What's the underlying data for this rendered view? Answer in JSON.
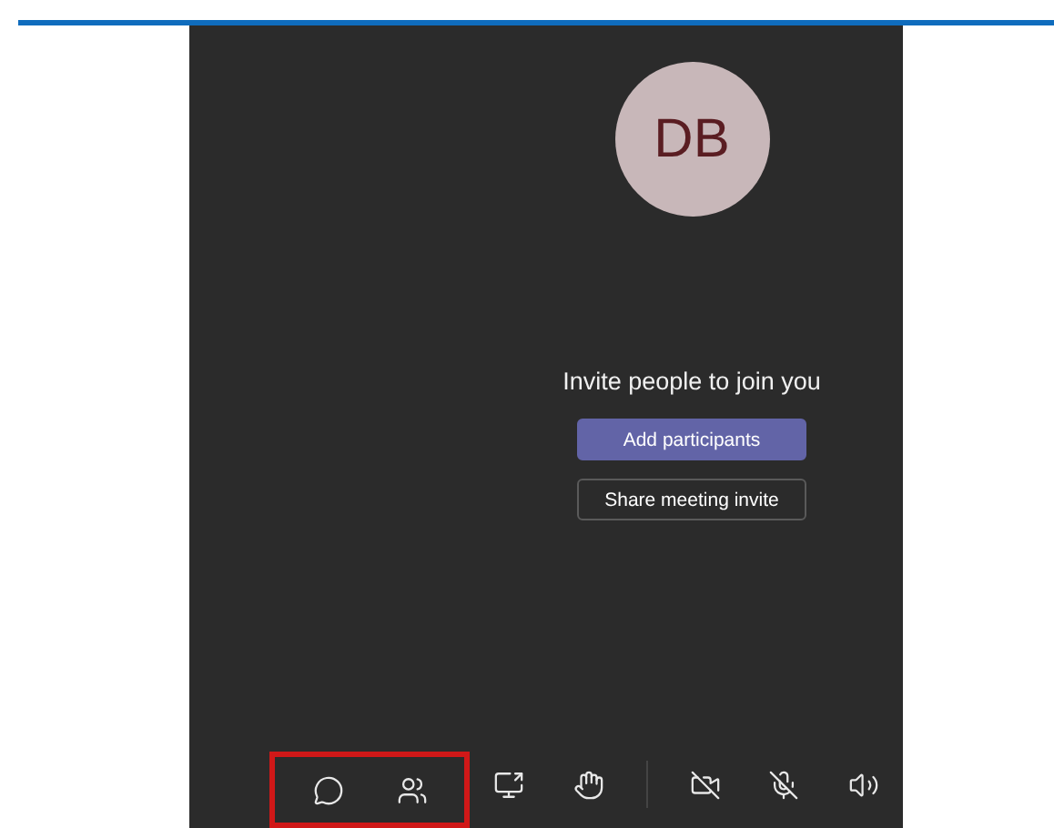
{
  "avatar": {
    "initials": "DB"
  },
  "invite": {
    "message": "Invite people to join you",
    "primary_button": "Add participants",
    "secondary_button": "Share meeting invite"
  },
  "toolbar": [
    {
      "kind": "chat",
      "highlighted": true
    },
    {
      "kind": "people",
      "highlighted": true
    },
    {
      "kind": "share",
      "highlighted": false
    },
    {
      "kind": "react",
      "highlighted": false
    },
    {
      "kind": "separator",
      "highlighted": false
    },
    {
      "kind": "camera",
      "on": false,
      "highlighted": false
    },
    {
      "kind": "mic",
      "on": false,
      "highlighted": false
    },
    {
      "kind": "speaker",
      "highlighted": false
    }
  ]
}
